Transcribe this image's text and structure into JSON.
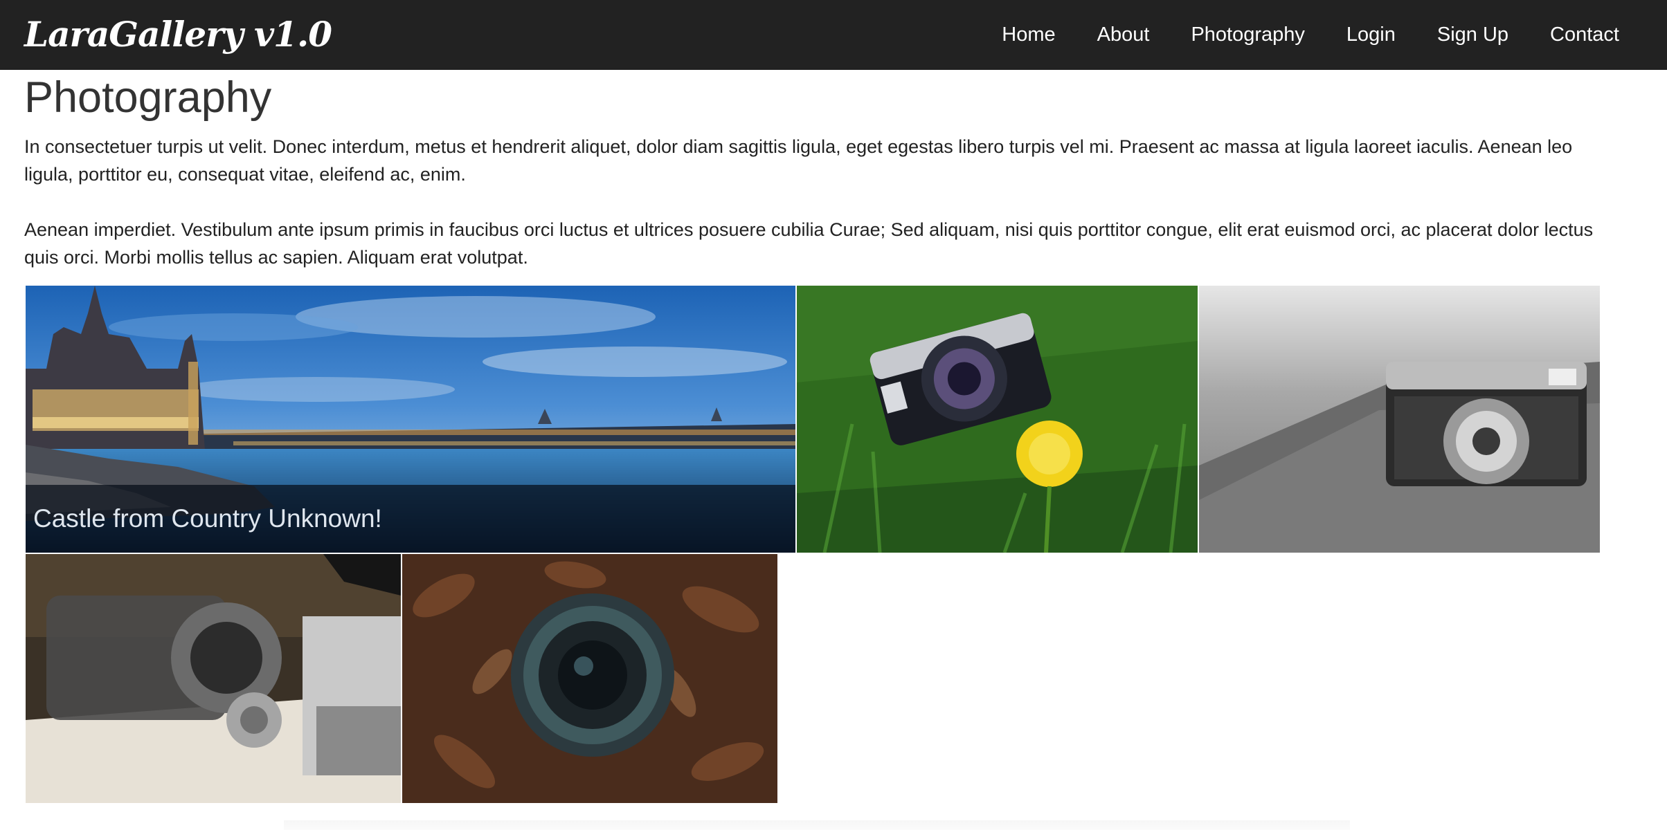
{
  "navbar": {
    "brand": "LaraGallery v1.0",
    "items": [
      {
        "label": "Home"
      },
      {
        "label": "About"
      },
      {
        "label": "Photography"
      },
      {
        "label": "Login"
      },
      {
        "label": "Sign Up"
      },
      {
        "label": "Contact"
      }
    ]
  },
  "page": {
    "title": "Photography",
    "paragraphs": [
      "In consectetuer turpis ut velit. Donec interdum, metus et hendrerit aliquet, dolor diam sagittis ligula, eget egestas libero turpis vel mi. Praesent ac massa at ligula laoreet iaculis. Aenean leo ligula, porttitor eu, consequat vitae, eleifend ac, enim.",
      "Aenean imperdiet. Vestibulum ante ipsum primis in faucibus orci luctus et ultrices posuere cubilia Curae; Sed aliquam, nisi quis porttitor congue, elit erat euismod orci, ac placerat dolor lectus quis orci. Morbi mollis tellus ac sapien. Aliquam erat volutpat."
    ]
  },
  "gallery": {
    "photos": [
      {
        "caption": "Castle from Country Unknown!"
      }
    ]
  },
  "colors": {
    "navbar_bg": "#222222",
    "nav_text": "#ffffff",
    "caption_overlay": "#050c18"
  }
}
